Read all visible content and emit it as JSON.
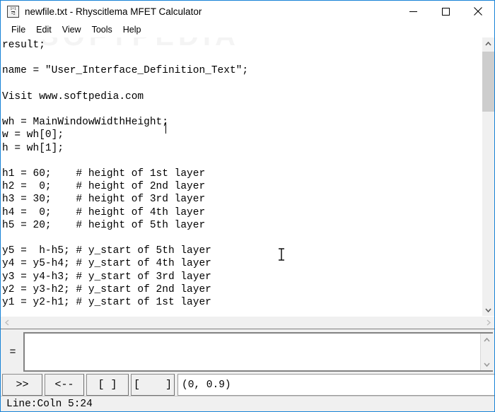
{
  "window": {
    "title": "newfile.txt - Rhyscitlema MFET Calculator",
    "icon_name": "calculator-icon",
    "icon_row1": "1+1",
    "icon_row2": "=2",
    "accent_border": "#1883d7",
    "controls": {
      "minimize": "minimize-icon",
      "maximize": "maximize-icon",
      "close": "close-icon"
    }
  },
  "watermark": "SOFTPEDIA",
  "menubar": {
    "items": [
      {
        "label": "File"
      },
      {
        "label": "Edit"
      },
      {
        "label": "View"
      },
      {
        "label": "Tools"
      },
      {
        "label": "Help"
      }
    ]
  },
  "editor": {
    "content": "result;\n\nname = \"User_Interface_Definition_Text\";\n\nVisit www.softpedia.com\n\nwh = MainWindowWidthHeight;\nw = wh[0];\nh = wh[1];\n\nh1 = 60;    # height of 1st layer\nh2 =  0;    # height of 2nd layer\nh3 = 30;    # height of 3rd layer\nh4 =  0;    # height of 4th layer\nh5 = 20;    # height of 5th layer\n\ny5 =  h-h5; # y_start of 5th layer\ny4 = y5-h4; # y_start of 4th layer\ny3 = y4-h3; # y_start of 3rd layer\ny2 = y3-h2; # y_start of 2nd layer\ny1 = y2-h1; # y_start of 1st layer",
    "vertical_scrollbar": {
      "up_arrow": "chevron-up-icon",
      "down_arrow": "chevron-down-icon"
    },
    "horizontal_scrollbar": {
      "left_arrow": "chevron-left-icon",
      "right_arrow": "chevron-right-icon"
    }
  },
  "result_panel": {
    "equals_label": "=",
    "output_value": "",
    "output_placeholder": "",
    "scroll_up": "chevron-up-icon",
    "scroll_down": "chevron-down-icon"
  },
  "buttonbar": {
    "buttons": [
      {
        "label": ">>",
        "name": "run-button"
      },
      {
        "label": "<--",
        "name": "back-button"
      },
      {
        "label": "[ ]",
        "name": "brackets-button"
      },
      {
        "label": "[    ]",
        "name": "wide-brackets-button"
      }
    ],
    "coordinate_value": "(0, 0.9)"
  },
  "statusbar": {
    "text": "Line:Coln 5:24"
  }
}
